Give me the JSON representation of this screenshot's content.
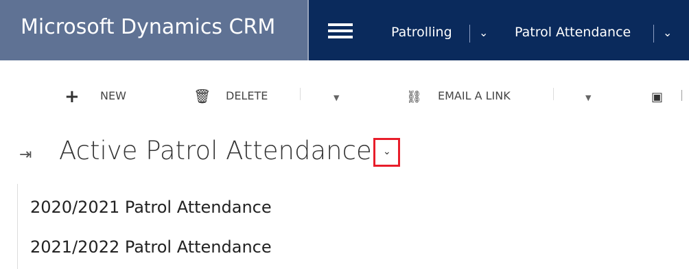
{
  "header": {
    "app_title": "Microsoft Dynamics CRM",
    "menu_items": [
      {
        "label": "Patrolling"
      },
      {
        "label": "Patrol Attendance"
      }
    ]
  },
  "toolbar": {
    "new_label": "NEW",
    "delete_label": "DELETE",
    "email_link_label": "EMAIL A LINK"
  },
  "view": {
    "title": "Active Patrol Attendance",
    "options": [
      {
        "label": "2020/2021 Patrol Attendance"
      },
      {
        "label": "2021/2022 Patrol Attendance"
      }
    ],
    "highlight_color": "#e81d2a"
  },
  "colors": {
    "brand_bg": "#5f7294",
    "nav_bg": "#0a2a5c"
  }
}
